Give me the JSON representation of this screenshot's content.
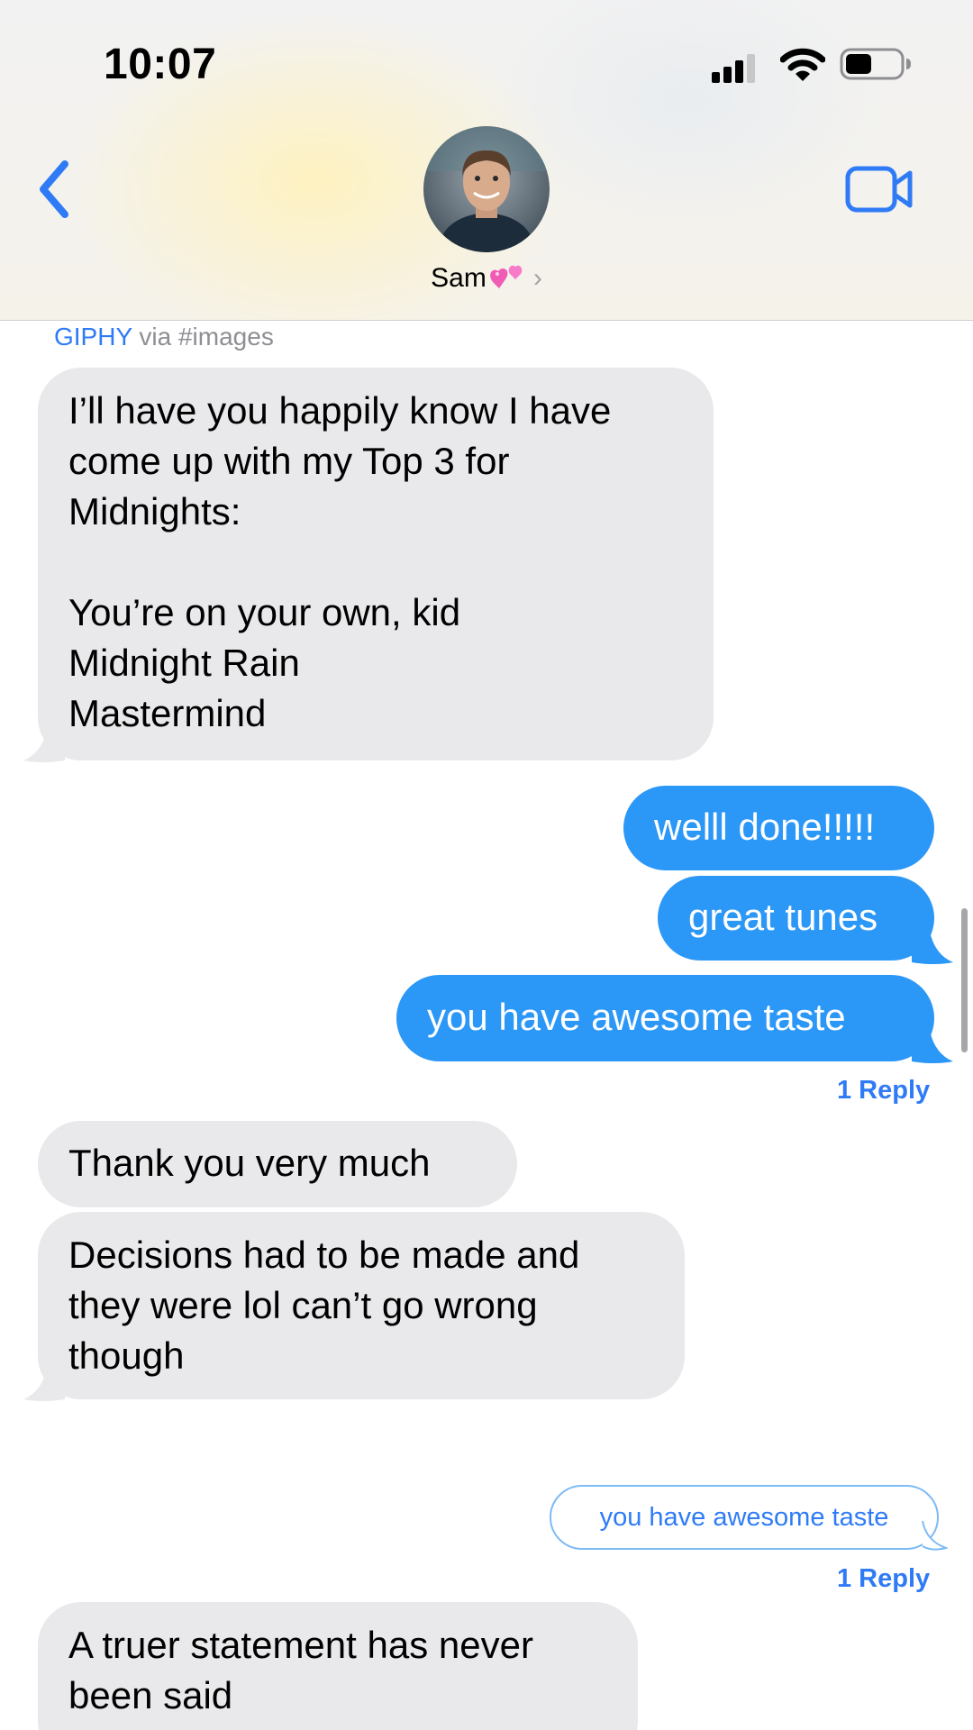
{
  "status_bar": {
    "time": "10:07"
  },
  "header": {
    "contact_name": "Sam",
    "back_icon": "chevron-left-icon",
    "video_icon": "video-camera-icon",
    "name_emoji": "two-hearts-emoji"
  },
  "attribution": {
    "brand": "GIPHY",
    "via": "via #images"
  },
  "messages": [
    {
      "direction": "incoming",
      "text": "I’ll have you happily know I have\ncome up with my Top 3 for\nMidnights:\n\nYou’re on your own, kid\nMidnight Rain\nMastermind"
    },
    {
      "direction": "outgoing",
      "text": "welll done!!!!!"
    },
    {
      "direction": "outgoing",
      "text": "great tunes"
    },
    {
      "direction": "outgoing",
      "text": "you have awesome taste",
      "reply_count": "1 Reply"
    },
    {
      "direction": "incoming",
      "text": "Thank you very much"
    },
    {
      "direction": "incoming",
      "text": "Decisions had to be made and\nthey were lol can’t go wrong\nthough"
    },
    {
      "direction": "outgoing-quoted",
      "text": "you have awesome taste",
      "reply_count": "1 Reply"
    },
    {
      "direction": "incoming",
      "text": "A truer statement has never\nbeen said"
    }
  ],
  "colors": {
    "incoming_bubble": "#e9e9eb",
    "outgoing_bubble": "#2b97f7",
    "accent": "#2f7bf6"
  }
}
